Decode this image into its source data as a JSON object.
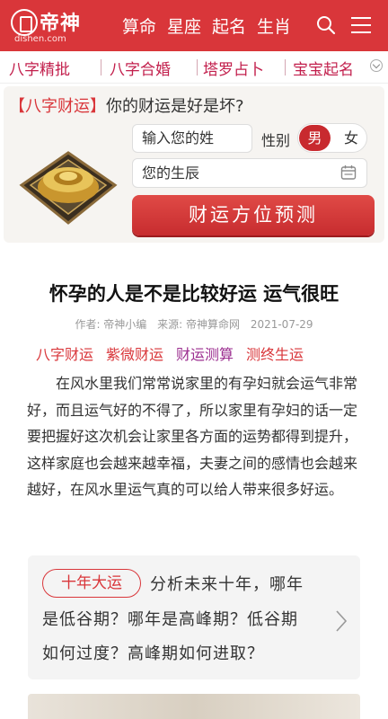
{
  "header": {
    "logo_text": "帝神",
    "logo_sub": "dishen.com",
    "nav": [
      "算命",
      "星座",
      "起名",
      "生肖"
    ],
    "bg_color": "#d9363a"
  },
  "categories": [
    "八字精批",
    "八字合婚",
    "塔罗占卜",
    "宝宝起名"
  ],
  "fortune_panel": {
    "title_bracket": "【八字财运】",
    "title_question": "你的财运是好是坏?",
    "name_placeholder": "输入您的姓",
    "gender_label": "性别",
    "gender_male": "男",
    "gender_female": "女",
    "birth_placeholder": "您的生辰",
    "button_label": "财运方位预测"
  },
  "article": {
    "title": "怀孕的人是不是比较好运 运气很旺",
    "author": "作者: 帝神小编",
    "source": "来源: 帝神算命网",
    "date": "2021-07-29",
    "tags": [
      {
        "label": "八字财运",
        "color": "#d9363a"
      },
      {
        "label": "紫微财运",
        "color": "#d9363a"
      },
      {
        "label": "财运测算",
        "color": "#9b2d8f"
      },
      {
        "label": "测终生运",
        "color": "#d9363a"
      }
    ],
    "paragraph": "在风水里我们常常说家里的有孕妇就会运气非常好，而且运气好的不得了，所以家里有孕妇的话一定要把握好这次机会让家里各方面的运势都得到提升，这样家庭也会越来越幸福，夫妻之间的感情也会越来越好，在风水里运气真的可以给人带来很多好运。"
  },
  "promo": {
    "tag": "十年大运",
    "line1": "分析未来十年，哪年",
    "line2": "是低谷期？哪年是高峰期？低谷期",
    "line3": "如何过度？高峰期如何进取？"
  }
}
